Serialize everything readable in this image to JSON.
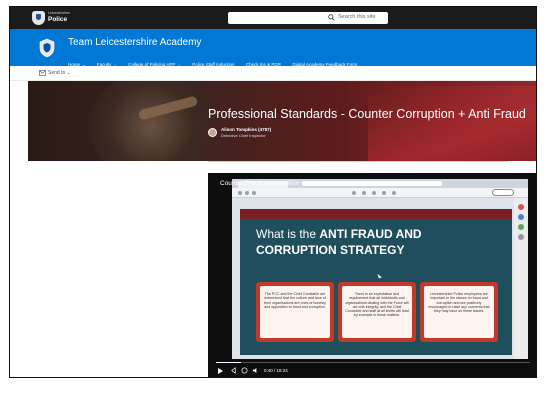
{
  "suitebar": {
    "org_subtitle": "Leicestershire",
    "org_name": "Police",
    "search_placeholder": "Search this site"
  },
  "site": {
    "title": "Team Leicestershire Academy",
    "nav": [
      {
        "label": "Home",
        "has_dropdown": true
      },
      {
        "label": "Faculty",
        "has_dropdown": true
      },
      {
        "label": "College of Policing APP",
        "has_dropdown": true
      },
      {
        "label": "Police Staff Induction",
        "has_dropdown": false
      },
      {
        "label": "Check Ins & PDR",
        "has_dropdown": false
      },
      {
        "label": "Digital Academy Feedback Form",
        "has_dropdown": false
      }
    ]
  },
  "command_bar": {
    "send_to": "Send to"
  },
  "hero": {
    "title": "Professional Standards - Counter Corruption + Anti Fraud",
    "author_name": "Alison Tompkins (4787)",
    "author_role": "Detective Chief Inspector"
  },
  "video": {
    "title": "Counter Fraud presentation",
    "progress_fraction": 0.08,
    "time": "0:40 / 18:24"
  },
  "slide": {
    "title_prefix": "What is the ",
    "title_bold": "ANTI FRAUD AND",
    "title_line2": "CORRUPTION STRATEGY",
    "boxes": [
      "The PCC and the Chief Constable are determined that the culture and tone of their organisations are ones of honesty and opposition to fraud and corruption.",
      "There is an expectation and requirement that all individuals and organisations dealing with the Force will act with integrity, and the Chief Constable and staff at all levels will lead by example in these matters.",
      "Leicestershire Police employees are important in the stance on fraud and corruption and are positively encouraged to raise any concerns that they may have on these issues."
    ]
  },
  "colors": {
    "suitebar": "#1b1b1b",
    "site_header": "#0078d4",
    "slide_bg": "#1f4e5c",
    "slide_accent": "#c0392b"
  }
}
